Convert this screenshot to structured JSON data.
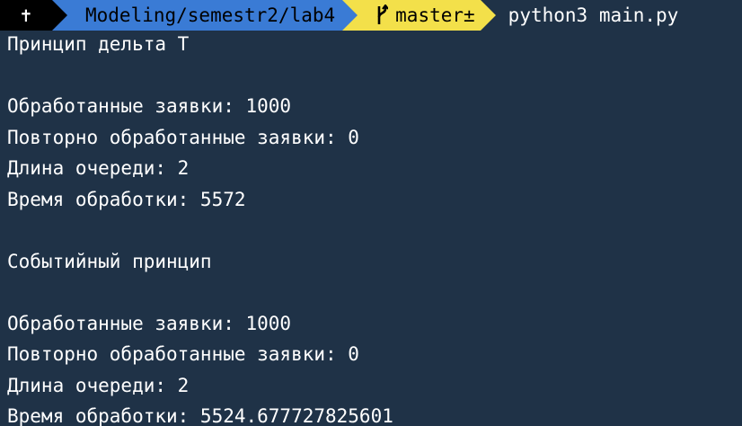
{
  "prompt": {
    "root_symbol": "✝",
    "directory": "Modeling/semestr2/lab4",
    "branch": "master±",
    "command": "python3 main.py"
  },
  "output_lines": [
    "Принцип дельта T",
    "",
    "Обработанные заявки: 1000",
    "Повторно обработанные заявки: 0",
    "Длина очереди: 2",
    "Время обработки: 5572",
    "",
    "Событийный принцип",
    "",
    "Обработанные заявки: 1000",
    "Повторно обработанные заявки: 0",
    "Длина очереди: 2",
    "Время обработки: 5524.677727825601"
  ],
  "colors": {
    "background": "#1f3247",
    "segment_root": "#000000",
    "segment_dir": "#3a7bd5",
    "segment_git": "#f3e04a"
  }
}
